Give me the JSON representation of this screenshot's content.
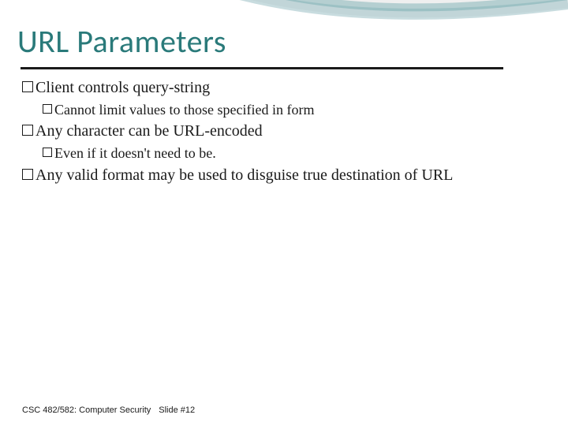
{
  "title": "URL Parameters",
  "bullets": {
    "b1": "Client controls query-string",
    "b1a": "Cannot limit values to those specified in form",
    "b2": "Any character can be URL-encoded",
    "b2a": "Even if it doesn't need to be.",
    "b3": "Any valid format may be used to disguise true destination of URL"
  },
  "footer": {
    "course": "CSC 482/582: Computer Security",
    "slide": "Slide #12"
  }
}
